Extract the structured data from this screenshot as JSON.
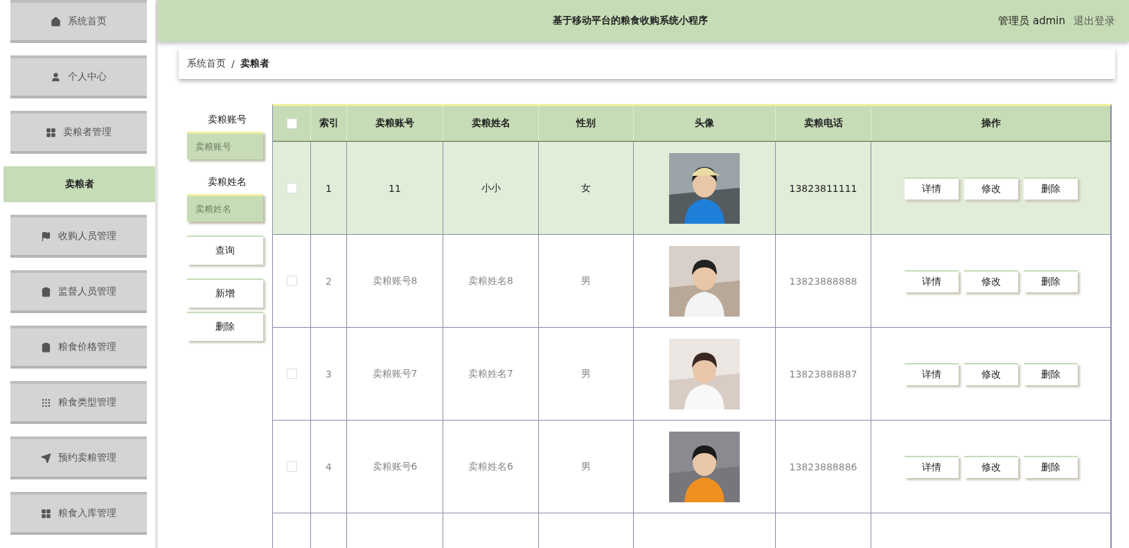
{
  "sidebar": {
    "items": [
      {
        "label": "系统首页",
        "kind": "group",
        "selected": false
      },
      {
        "label": "个人中心",
        "kind": "group",
        "selected": false
      },
      {
        "label": "卖粮者管理",
        "kind": "group",
        "selected": false
      },
      {
        "label": "卖粮者",
        "kind": "sub",
        "selected": true
      },
      {
        "label": "收购人员管理",
        "kind": "group",
        "selected": false
      },
      {
        "label": "监督人员管理",
        "kind": "group",
        "selected": false
      },
      {
        "label": "粮食价格管理",
        "kind": "group",
        "selected": false
      },
      {
        "label": "粮食类型管理",
        "kind": "group",
        "selected": false
      },
      {
        "label": "预约卖粮管理",
        "kind": "group",
        "selected": false
      },
      {
        "label": "粮食入库管理",
        "kind": "group",
        "selected": false
      }
    ]
  },
  "header": {
    "title": "基于移动平台的粮食收购系统小程序",
    "user": "管理员 admin",
    "logout": "退出登录"
  },
  "breadcrumb": [
    {
      "label": "系统首页"
    },
    {
      "label": "/"
    },
    {
      "label": "卖粮者"
    }
  ],
  "search": {
    "fields": [
      {
        "label": "卖粮账号",
        "placeholder": "卖粮账号"
      },
      {
        "label": "卖粮姓名",
        "placeholder": "卖粮姓名"
      }
    ],
    "query_button": "查询",
    "add_button": "新增",
    "delete_button": "删除"
  },
  "table": {
    "select_all": {
      "checked": false
    },
    "columns": [
      "索引",
      "卖粮账号",
      "卖粮姓名",
      "性别",
      "头像",
      "卖粮电话",
      "操作"
    ],
    "rows": [
      {
        "selected": true,
        "checked": false,
        "index": "1",
        "account": "11",
        "name": "小小",
        "gender": "女",
        "avatar": {
          "kind": "picture"
        },
        "phone": "13823811111",
        "actions": [
          "详情",
          "修改",
          "删除"
        ]
      },
      {
        "selected": false,
        "checked": false,
        "index": "2",
        "account": "卖粮账号8",
        "name": "卖粮姓名8",
        "gender": "男",
        "avatar": {
          "kind": "picture"
        },
        "phone": "13823888888",
        "actions": [
          "详情",
          "修改",
          "删除"
        ]
      },
      {
        "selected": false,
        "checked": false,
        "index": "3",
        "account": "卖粮账号7",
        "name": "卖粮姓名7",
        "gender": "男",
        "avatar": {
          "kind": "picture"
        },
        "phone": "13823888887",
        "actions": [
          "详情",
          "修改",
          "删除"
        ]
      },
      {
        "selected": false,
        "checked": false,
        "index": "4",
        "account": "卖粮账号6",
        "name": "卖粮姓名6",
        "gender": "男",
        "avatar": {
          "kind": "picture"
        },
        "phone": "13823888886",
        "actions": [
          "详情",
          "修改",
          "删除"
        ]
      }
    ]
  }
}
